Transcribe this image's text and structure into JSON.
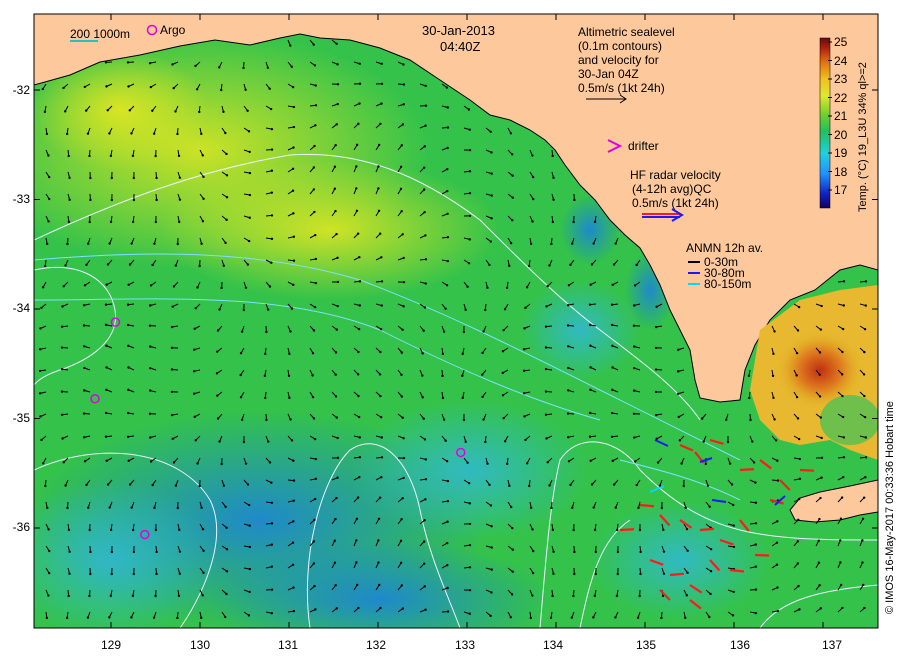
{
  "title": {
    "date": "30-Jan-2013",
    "time": "04:40Z"
  },
  "legend": {
    "isobath": "200  1000m",
    "argo": "Argo",
    "altimetry": [
      "Altimetric sealevel",
      "(0.1m contours)",
      "and velocity for",
      "30-Jan 04Z",
      "0.5m/s (1kt 24h)"
    ],
    "drifter": "drifter",
    "hf_radar": [
      "HF radar velocity",
      "(4-12h avg)QC",
      "0.5m/s (1kt 24h)"
    ],
    "anmn": {
      "title": "ANMN 12h av.",
      "depths": [
        "0-30m",
        "30-80m",
        "80-150m"
      ],
      "colors": [
        "#000000",
        "#1a1aff",
        "#00d8ff"
      ]
    }
  },
  "colorbar": {
    "label": "Temp. (°C) 19_L3U 34% ql>=2",
    "ticks": [
      "25",
      "24",
      "23",
      "22",
      "21",
      "20",
      "19",
      "18",
      "17"
    ],
    "min": 16.5,
    "max": 25
  },
  "y_ticks": [
    "-32",
    "-33",
    "-34",
    "-35",
    "-36"
  ],
  "x_ticks": [
    "129",
    "130",
    "131",
    "132",
    "133",
    "134",
    "135",
    "136",
    "137"
  ],
  "credit": "© IMOS 16-May-2017 00:33:36 Hobart time",
  "argo_floats": [
    {
      "lon": 129.05,
      "lat": -34.12
    },
    {
      "lon": 128.82,
      "lat": -34.82
    },
    {
      "lon": 129.38,
      "lat": -36.06
    },
    {
      "lon": 132.93,
      "lat": -35.31
    }
  ],
  "colors": {
    "land": "#fcc89c",
    "hf_radar": "#ff1a1a",
    "argo": "#e000e0",
    "contour": "#e8f4ff",
    "isobath": "#7fe0ff"
  }
}
